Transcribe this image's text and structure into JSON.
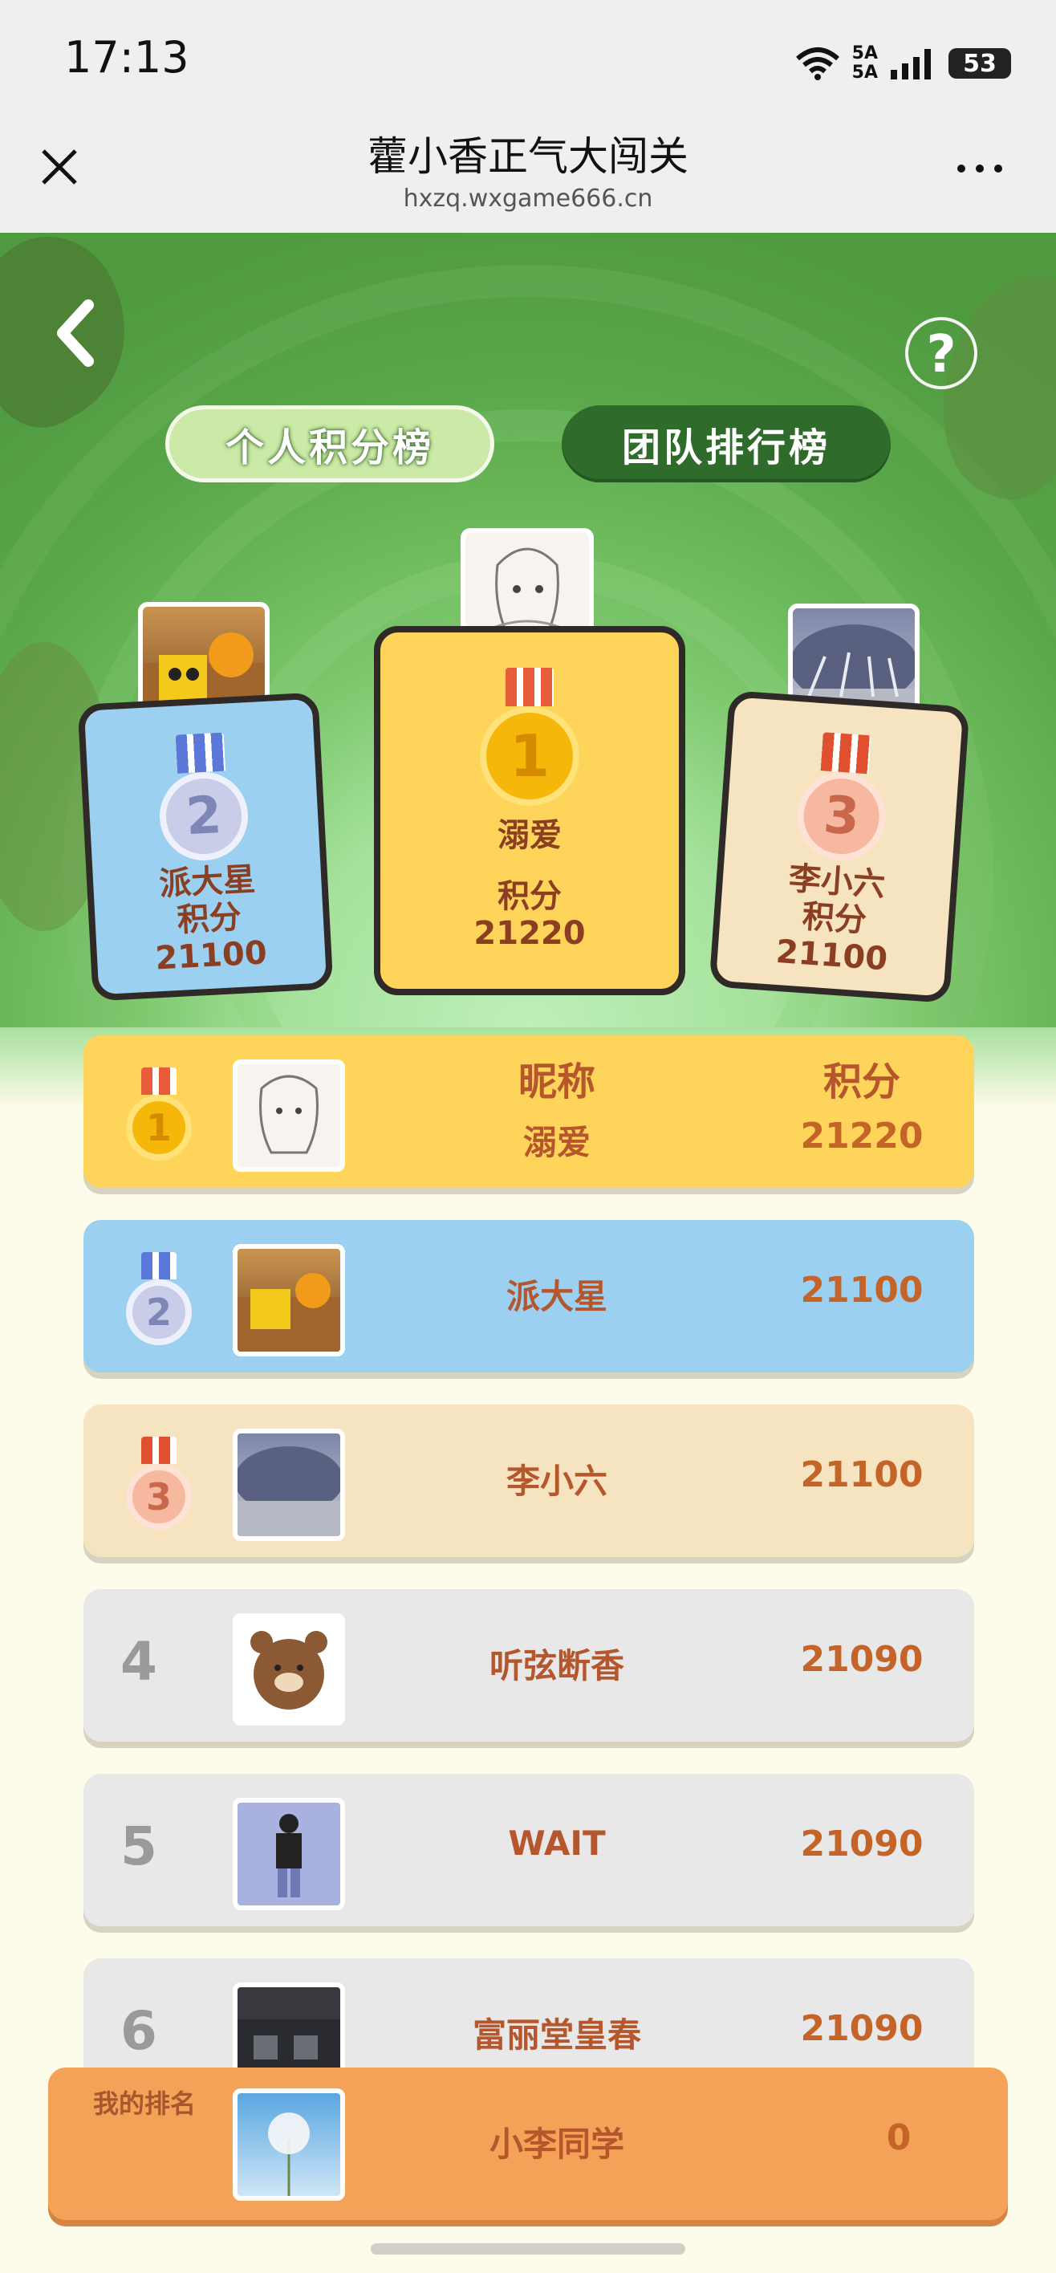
{
  "status": {
    "time": "17:13",
    "network": "5A",
    "battery": "53"
  },
  "header": {
    "title": "藿小香正气大闯关",
    "url": "hxzq.wxgame666.cn"
  },
  "tabs": [
    {
      "label": "个人积分榜",
      "active": true
    },
    {
      "label": "团队排行榜",
      "active": false
    }
  ],
  "podium": [
    {
      "rank": "2",
      "name": "派大星",
      "score_label": "积分",
      "score": "21100"
    },
    {
      "rank": "1",
      "name": "溺爱",
      "score_label": "积分",
      "score": "21220"
    },
    {
      "rank": "3",
      "name": "李小六",
      "score_label": "积分",
      "score": "21100"
    }
  ],
  "list_header": {
    "name": "昵称",
    "score": "积分"
  },
  "rows": [
    {
      "rank": "1",
      "name": "溺爱",
      "score": "21220"
    },
    {
      "rank": "2",
      "name": "派大星",
      "score": "21100"
    },
    {
      "rank": "3",
      "name": "李小六",
      "score": "21100"
    },
    {
      "rank": "4",
      "name": "听弦断香",
      "score": "21090"
    },
    {
      "rank": "5",
      "name": "WAIT",
      "score": "21090"
    },
    {
      "rank": "6",
      "name": "富丽堂皇春",
      "score": "21090"
    }
  ],
  "my_rank": {
    "label": "我的排名",
    "name": "小李同学",
    "score": "0"
  },
  "colors": {
    "gold": "#ffd45a",
    "silver_row": "#9bd0f1",
    "bronze_row": "#f5e4bf",
    "grey_row": "#e8e8e8",
    "my_rank": "#f3a257"
  }
}
